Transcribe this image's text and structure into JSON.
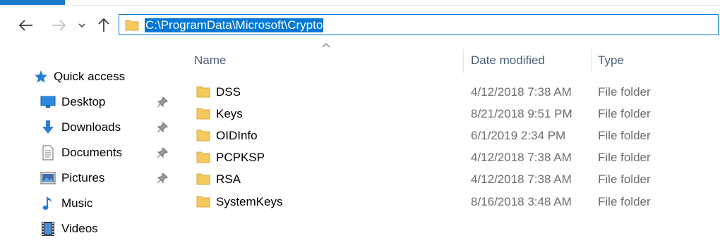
{
  "window": {
    "accent_color": "#1979ca"
  },
  "nav": {
    "back_icon": "arrow-left-icon",
    "forward_icon": "arrow-right-icon",
    "recent_icon": "chevron-down-icon",
    "up_icon": "arrow-up-icon",
    "address": "C:\\ProgramData\\Microsoft\\Crypto",
    "selection_color": "#0078d7"
  },
  "sidebar": {
    "quick_access": "Quick access",
    "items": [
      {
        "label": "Desktop",
        "icon": "desktop-icon",
        "pinned": true
      },
      {
        "label": "Downloads",
        "icon": "download-icon",
        "pinned": true
      },
      {
        "label": "Documents",
        "icon": "document-icon",
        "pinned": true
      },
      {
        "label": "Pictures",
        "icon": "pictures-icon",
        "pinned": true
      },
      {
        "label": "Music",
        "icon": "music-icon",
        "pinned": false
      },
      {
        "label": "Videos",
        "icon": "videos-icon",
        "pinned": false
      }
    ]
  },
  "columns": {
    "name": "Name",
    "date_modified": "Date modified",
    "type": "Type",
    "sort_icon": "sort-ascending-caret-icon"
  },
  "files": [
    {
      "name": "DSS",
      "date": "4/12/2018 7:38 AM",
      "type": "File folder"
    },
    {
      "name": "Keys",
      "date": "8/21/2018 9:51 PM",
      "type": "File folder"
    },
    {
      "name": "OIDInfo",
      "date": "6/1/2019 2:34 PM",
      "type": "File folder"
    },
    {
      "name": "PCPKSP",
      "date": "4/12/2018 7:38 AM",
      "type": "File folder"
    },
    {
      "name": "RSA",
      "date": "4/12/2018 7:38 AM",
      "type": "File folder"
    },
    {
      "name": "SystemKeys",
      "date": "8/16/2018 3:48 AM",
      "type": "File folder"
    }
  ],
  "folder_color": "#f4c95d"
}
